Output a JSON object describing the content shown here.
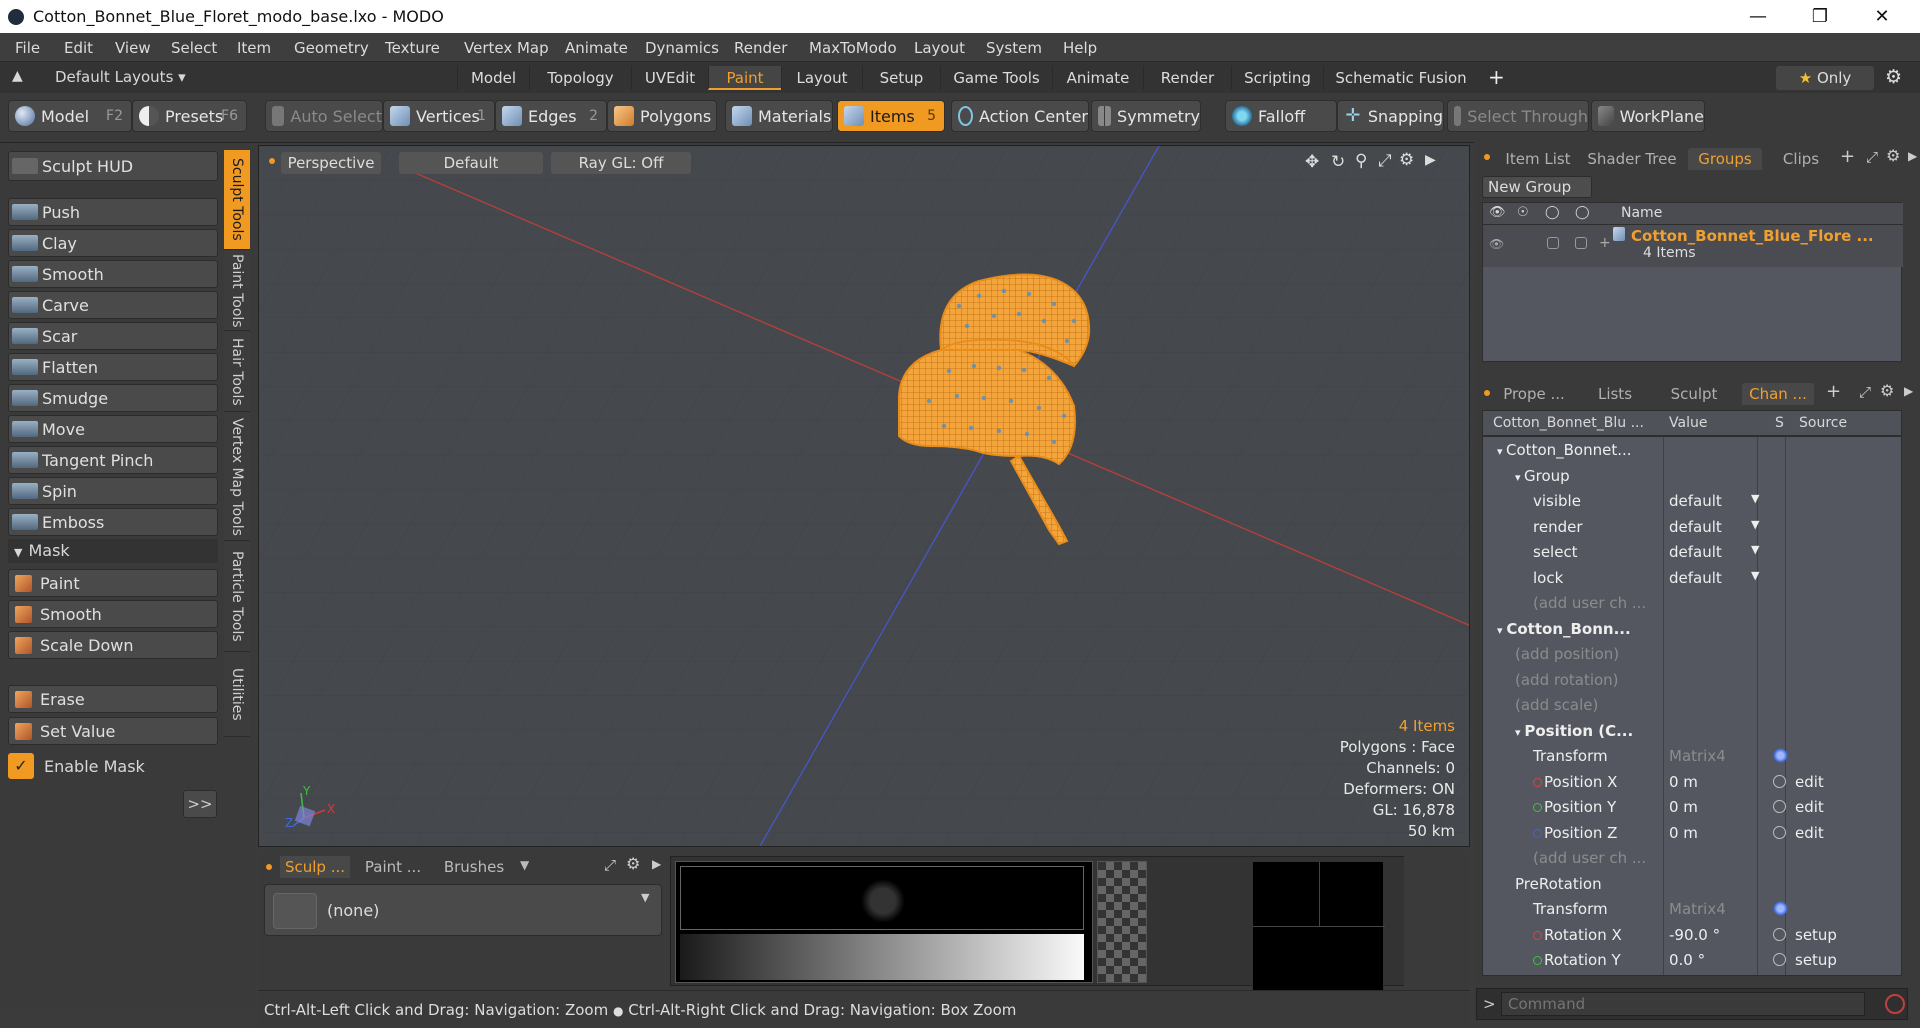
{
  "window": {
    "title": "Cotton_Bonnet_Blue_Floret_modo_base.lxo - MODO",
    "minimize_icon": "minimize-icon",
    "maximize_icon": "restore-icon",
    "close_icon": "close-icon"
  },
  "menu": [
    "File",
    "Edit",
    "View",
    "Select",
    "Item",
    "Geometry",
    "Texture",
    "Vertex Map",
    "Animate",
    "Dynamics",
    "Render",
    "MaxToModo",
    "Layout",
    "System",
    "Help"
  ],
  "layout_tabs": {
    "layouts_label": "Default Layouts",
    "tabs": [
      "Model",
      "Topology",
      "UVEdit",
      "Paint",
      "Layout",
      "Setup",
      "Game Tools",
      "Animate",
      "Render",
      "Scripting",
      "Schematic Fusion"
    ],
    "active_tab": "Paint",
    "add_label": "+",
    "only_label": "Only"
  },
  "toolbar": {
    "model": "Model",
    "model_key": "F2",
    "presets": "Presets",
    "presets_key": "F6",
    "auto_select": "Auto Select",
    "vertices": "Vertices",
    "vertices_count": "1",
    "edges": "Edges",
    "edges_count": "2",
    "polygons": "Polygons",
    "materials": "Materials",
    "items": "Items",
    "items_count": "5",
    "action_center": "Action Center",
    "symmetry": "Symmetry",
    "falloff": "Falloff",
    "snapping": "Snapping",
    "select_through": "Select Through",
    "workplane": "WorkPlane"
  },
  "sculpt": {
    "hud": "Sculpt HUD",
    "tools": [
      "Push",
      "Clay",
      "Smooth",
      "Carve",
      "Scar",
      "Flatten",
      "Smudge",
      "Move",
      "Tangent Pinch",
      "Spin",
      "Emboss"
    ],
    "mask_header": "Mask",
    "mask_tools": [
      "Paint",
      "Smooth",
      "Scale Down"
    ],
    "extra_tools": [
      "Erase",
      "Set Value"
    ],
    "enable_mask": "Enable Mask",
    "expand": ">>",
    "side_tabs": [
      "Sculpt Tools",
      "Paint Tools",
      "Hair Tools",
      "Vertex Map Tools",
      "Particle Tools",
      "Utilities"
    ]
  },
  "viewport": {
    "view": "Perspective",
    "style": "Default",
    "raygl": "Ray GL: Off",
    "stats": {
      "items": "4 Items",
      "polygons": "Polygons : Face",
      "channels": "Channels: 0",
      "deformers": "Deformers: ON",
      "gl": "GL: 16,878",
      "scale": "50 km"
    },
    "axis_x": "X",
    "axis_y": "Y",
    "axis_z": "Z"
  },
  "bottom": {
    "tabs": [
      "Sculp ...",
      "Paint ...",
      "Brushes"
    ],
    "brush_value": "(none)"
  },
  "status": {
    "text1": "Ctrl-Alt-Left Click and Drag: Navigation: Zoom",
    "text2": "Ctrl-Alt-Right Click and Drag: Navigation: Box Zoom"
  },
  "groups_panel": {
    "tabs": [
      "Item List",
      "Shader Tree",
      "Groups",
      "Clips"
    ],
    "active_tab": "Groups",
    "new_group": "New Group",
    "col_name": "Name",
    "group_name": "Cotton_Bonnet_Blue_Flore ...",
    "group_count": "4 Items"
  },
  "channels_panel": {
    "tabs": [
      "Prope ...",
      "Lists",
      "Sculpt",
      "Chan ..."
    ],
    "active_tab": "Chan ...",
    "headers": {
      "name": "Cotton_Bonnet_Blu ...",
      "value": "Value",
      "s": "S",
      "source": "Source"
    },
    "rows": [
      {
        "indent": 0,
        "label": "Cotton_Bonnet...",
        "type": "item"
      },
      {
        "indent": 1,
        "label": "Group",
        "type": "item"
      },
      {
        "indent": 2,
        "label": "visible",
        "value": "default",
        "dd": true
      },
      {
        "indent": 2,
        "label": "render",
        "value": "default",
        "dd": true
      },
      {
        "indent": 2,
        "label": "select",
        "value": "default",
        "dd": true
      },
      {
        "indent": 2,
        "label": "lock",
        "value": "default",
        "dd": true
      },
      {
        "indent": 2,
        "label": "(add user ch ...",
        "gray": true
      },
      {
        "indent": 0,
        "label": "Cotton_Bonn...",
        "bold": true
      },
      {
        "indent": 1,
        "label": "(add position)",
        "gray": true
      },
      {
        "indent": 1,
        "label": "(add rotation)",
        "gray": true
      },
      {
        "indent": 1,
        "label": "(add scale)",
        "gray": true
      },
      {
        "indent": 1,
        "label": "Position (C...",
        "bold": true
      },
      {
        "indent": 2,
        "label": "Transform",
        "value": "Matrix4",
        "valgray": true,
        "gear": true
      },
      {
        "indent": 2,
        "label": "Position X",
        "value": "0 m",
        "source": "edit",
        "dot": "#e04040"
      },
      {
        "indent": 2,
        "label": "Position Y",
        "value": "0 m",
        "source": "edit",
        "dot": "#40c040"
      },
      {
        "indent": 2,
        "label": "Position Z",
        "value": "0 m",
        "source": "edit",
        "dot": "#4060e0"
      },
      {
        "indent": 2,
        "label": "(add user ch ...",
        "gray": true
      },
      {
        "indent": 1,
        "label": "PreRotation"
      },
      {
        "indent": 2,
        "label": "Transform",
        "value": "Matrix4",
        "valgray": true,
        "gear": true
      },
      {
        "indent": 2,
        "label": "Rotation X",
        "value": "-90.0 °",
        "source": "setup",
        "dot": "#e04040"
      },
      {
        "indent": 2,
        "label": "Rotation Y",
        "value": "0.0 °",
        "source": "setup",
        "dot": "#40c040"
      }
    ]
  },
  "command": {
    "placeholder": "Command",
    "prompt": ">"
  },
  "colors": {
    "accent": "#f09a22",
    "grid_x": "#c0392b",
    "grid_z": "#3d52c9",
    "model": "#f3a43a"
  }
}
